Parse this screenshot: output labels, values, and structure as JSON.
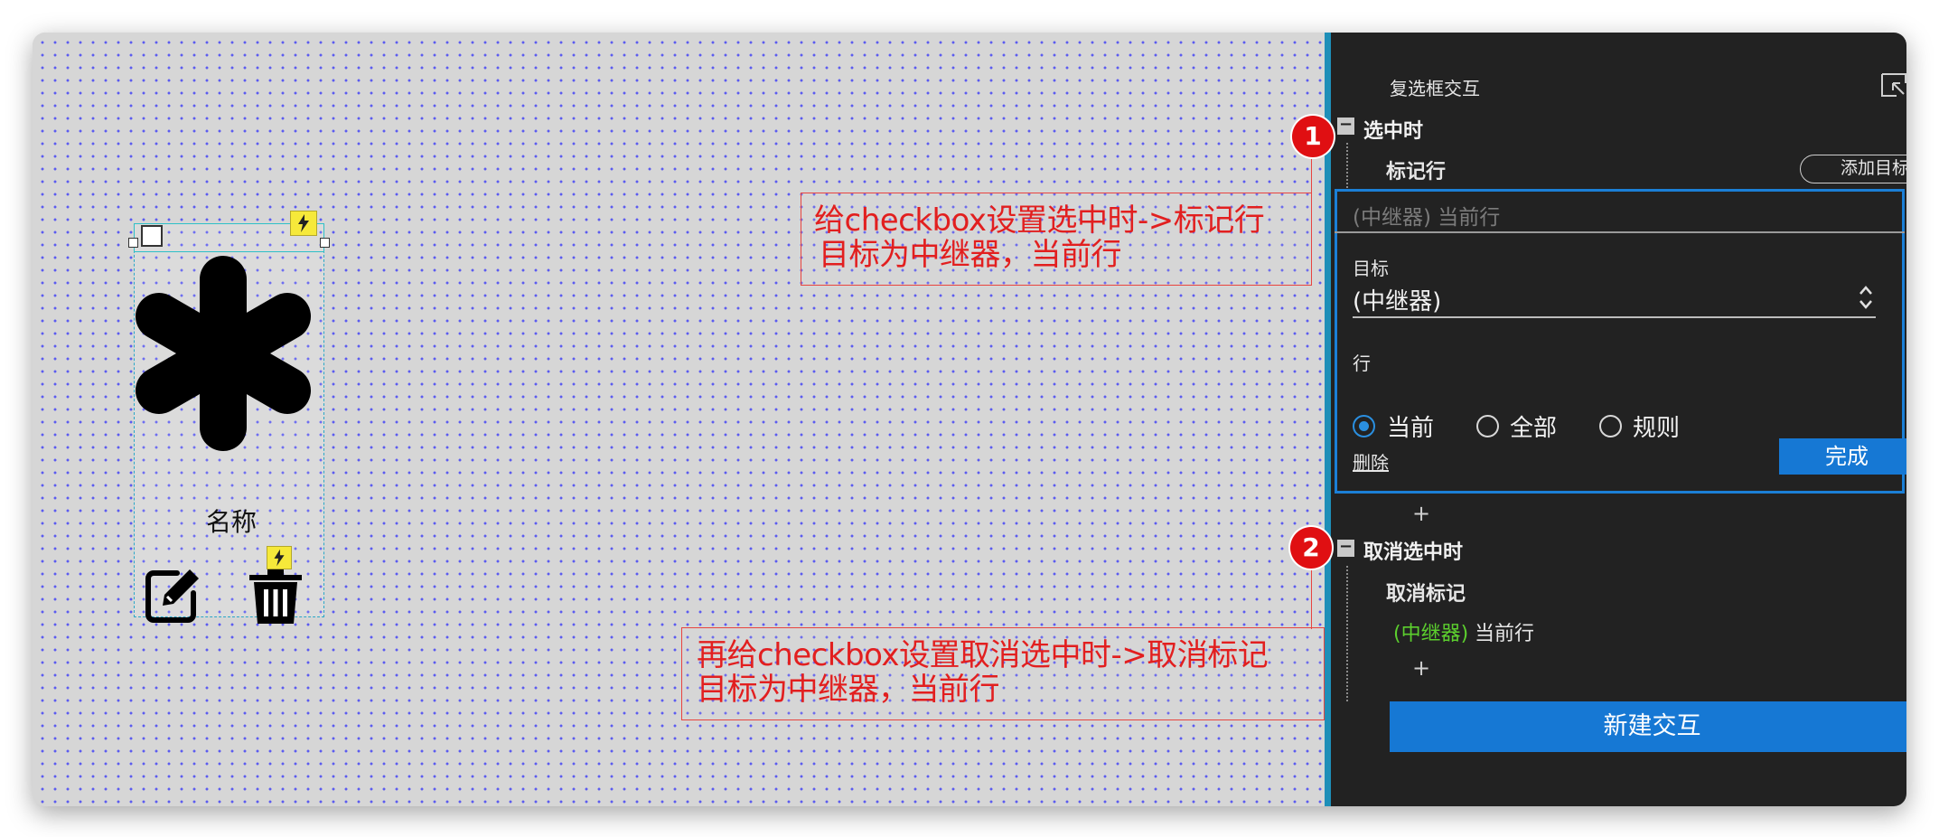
{
  "canvas": {
    "widget_label": "名称"
  },
  "annotations": [
    {
      "number": "1",
      "lines": [
        "给checkbox设置选中时->标记行",
        "目标为中继器，当前行"
      ]
    },
    {
      "number": "2",
      "lines": [
        "再给checkbox设置取消选中时->取消标记",
        "目标为中继器，当前行"
      ]
    }
  ],
  "panel": {
    "title": "复选框交互",
    "checked_event": {
      "label": "选中时",
      "action": "标记行",
      "add_target_label": "添加目标",
      "editor": {
        "header": "(中继器) 当前行",
        "target_label": "目标",
        "target_value": "(中继器)",
        "row_label": "行",
        "options": [
          "当前",
          "全部",
          "规则"
        ],
        "selected_option": "当前",
        "delete_label": "删除",
        "done_label": "完成"
      },
      "plus": "+"
    },
    "unchecked_event": {
      "label": "取消选中时",
      "action": "取消标记",
      "target_repeater": "(中继器)",
      "target_row": "当前行",
      "plus": "+"
    },
    "new_interaction_label": "新建交互"
  },
  "colors": {
    "accent_blue": "#1678d4",
    "annotation_red": "#e21f1f",
    "repeater_green": "#5ccf2e",
    "panel_bg": "#222222"
  },
  "icons": [
    "asterisk-icon",
    "edit-icon",
    "trash-icon",
    "lightning-icon",
    "collapse-panel-icon",
    "updown-chevron-icon"
  ]
}
